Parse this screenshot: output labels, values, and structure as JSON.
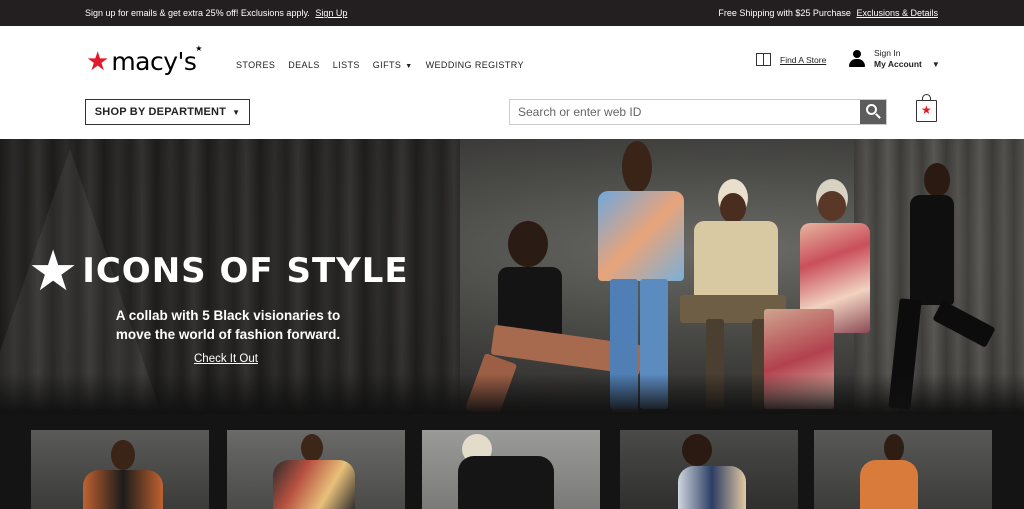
{
  "promo": {
    "left_text": "Sign up for emails & get extra 25% off! Exclusions apply.",
    "left_link": "Sign Up",
    "right_text": "Free Shipping with $25 Purchase",
    "right_link": "Exclusions & Details"
  },
  "brand": {
    "name": "macy's",
    "star_color": "#e11a2b"
  },
  "nav": {
    "items": [
      {
        "label": "STORES"
      },
      {
        "label": "DEALS"
      },
      {
        "label": "LISTS"
      },
      {
        "label": "GIFTS"
      },
      {
        "label": "WEDDING REGISTRY"
      }
    ]
  },
  "header": {
    "find_store": "Find A Store",
    "sign_in": "Sign In",
    "my_account": "My Account",
    "shop_by_department": "SHOP BY DEPARTMENT"
  },
  "search": {
    "placeholder": "Search or enter web ID"
  },
  "hero": {
    "title": "ICONS OF STYLE",
    "subtitle_line1": "A collab with 5 Black visionaries to",
    "subtitle_line2": "move the world of fashion forward.",
    "cta": "Check It Out"
  },
  "icons": {
    "logo_star": "star-icon",
    "store": "map-icon",
    "account": "user-icon",
    "search": "search-icon",
    "bag": "shopping-bag-icon"
  }
}
